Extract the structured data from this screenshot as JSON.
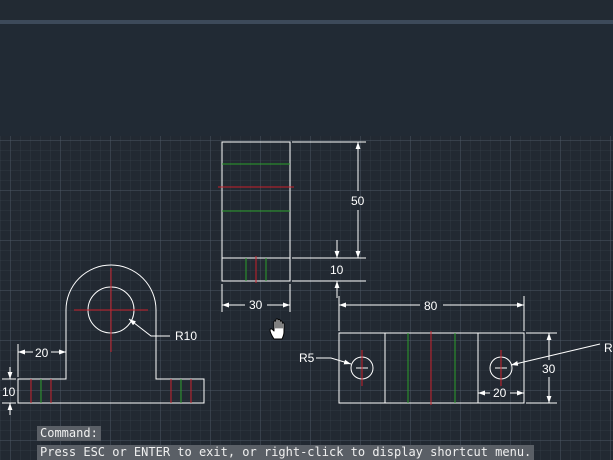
{
  "dimensions": {
    "side_height": "50",
    "side_base": "10",
    "side_width": "30",
    "front_radius": "R10",
    "front_ledge": "20",
    "front_base": "10",
    "top_length": "80",
    "top_hole_radius": "R5",
    "top_right_radius": "R",
    "top_width": "30",
    "top_hole_offset": "20"
  },
  "command": {
    "label": "Command:",
    "message": "Press ESC or ENTER to exit, or right-click to display shortcut menu."
  },
  "colors": {
    "background": "#212830",
    "geometry": "#ffffff",
    "centerline": "#c8202a",
    "hidden_line": "#2aa02a"
  },
  "cursor_icon": "pan-hand-icon"
}
